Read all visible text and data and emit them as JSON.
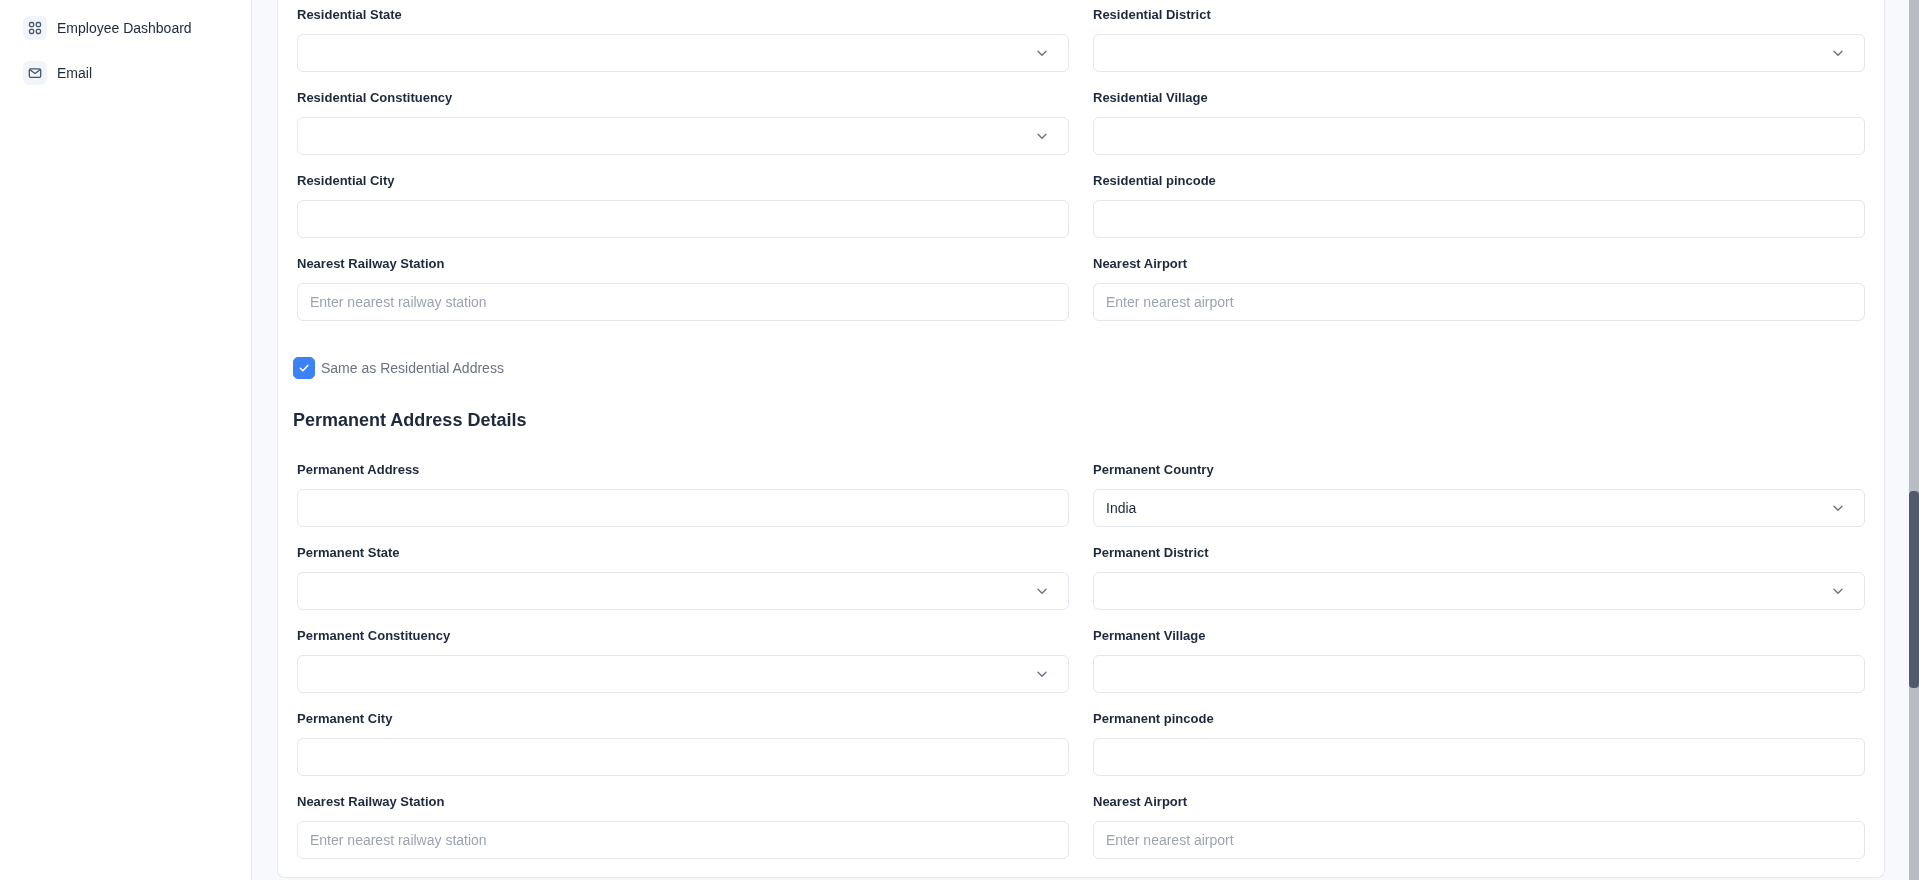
{
  "sidebar": {
    "items": [
      {
        "label": "Employee Dashboard",
        "selected": false
      },
      {
        "label": "Email",
        "selected": false
      }
    ]
  },
  "residential_section": {
    "fields": [
      {
        "label": "Residential State",
        "kind": "select"
      },
      {
        "label": "Residential District",
        "kind": "select"
      },
      {
        "label": "Residential Constituency",
        "kind": "select"
      },
      {
        "label": "Residential Village",
        "kind": "text"
      },
      {
        "label": "Residential City",
        "kind": "text"
      },
      {
        "label": "Residential pincode",
        "kind": "text"
      },
      {
        "label": "Nearest Railway Station",
        "kind": "text",
        "placeholder": "Enter nearest railway station"
      },
      {
        "label": "Nearest Airport",
        "kind": "text",
        "placeholder": "Enter nearest airport"
      }
    ]
  },
  "same_as_residential": {
    "label": "Same as Residential Address",
    "checked": true
  },
  "permanent_section": {
    "title": "Permanent Address Details",
    "fields": [
      {
        "label": "Permanent Address",
        "kind": "text"
      },
      {
        "label": "Permanent Country",
        "kind": "select",
        "value": "India"
      },
      {
        "label": "Permanent State",
        "kind": "select"
      },
      {
        "label": "Permanent District",
        "kind": "select"
      },
      {
        "label": "Permanent Constituency",
        "kind": "select"
      },
      {
        "label": "Permanent Village",
        "kind": "text"
      },
      {
        "label": "Permanent City",
        "kind": "text"
      },
      {
        "label": "Permanent pincode",
        "kind": "text"
      },
      {
        "label": "Nearest Railway Station",
        "kind": "text",
        "placeholder": "Enter nearest railway station"
      },
      {
        "label": "Nearest Airport",
        "kind": "text",
        "placeholder": "Enter nearest airport"
      }
    ]
  }
}
